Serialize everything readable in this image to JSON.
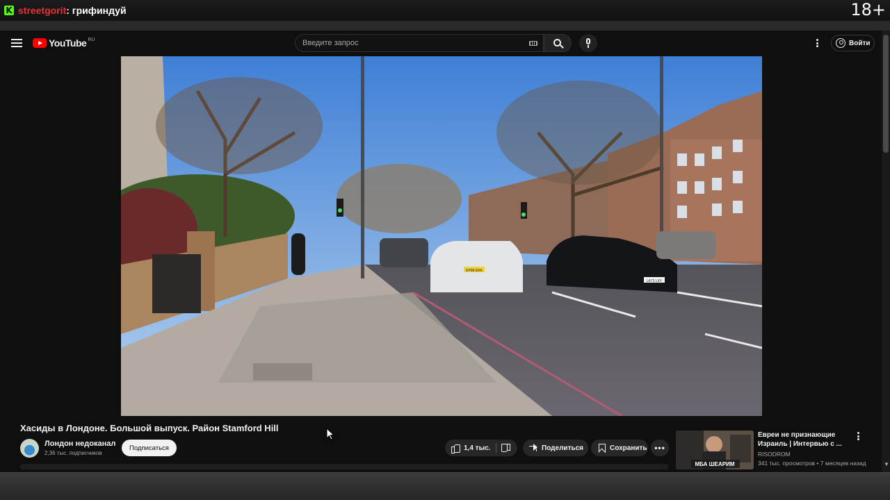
{
  "stream_overlay": {
    "platform_icon": "kick-logo-icon",
    "platform_letter": "K",
    "streamer": "streetgorit",
    "separator": ":",
    "title_rest": " грифиндуй",
    "age_rating": "18+"
  },
  "youtube": {
    "logo_text": "YouTube",
    "region": "RU",
    "search": {
      "placeholder": "Введите запрос",
      "value": ""
    },
    "signin_label": "Войти"
  },
  "video": {
    "title": "Хасиды в Лондоне. Большой выпуск. Район Stamford Hill",
    "channel_name": "Лондон недоканал",
    "subscribers": "2,36 тыс. подписчиков",
    "subscribe_label": "Подписаться",
    "likes": "1,4 тыс.",
    "share_label": "Поделиться",
    "save_label": "Сохранить",
    "plates": [
      "KP68 ERK",
      "LA73 LKY"
    ]
  },
  "recommendation": {
    "title": "Евреи не признающие Израиль | Интервью с ...",
    "channel": "RISODROM",
    "meta": "341 тыс. просмотров • 7 месяцев назад",
    "thumb_caption": "МБА ШЕАРИМ"
  },
  "colors": {
    "youtube_red": "#ff0000",
    "kick_green": "#53fc18",
    "streamer_red": "#e63232",
    "page_bg": "#0f0f0f"
  }
}
